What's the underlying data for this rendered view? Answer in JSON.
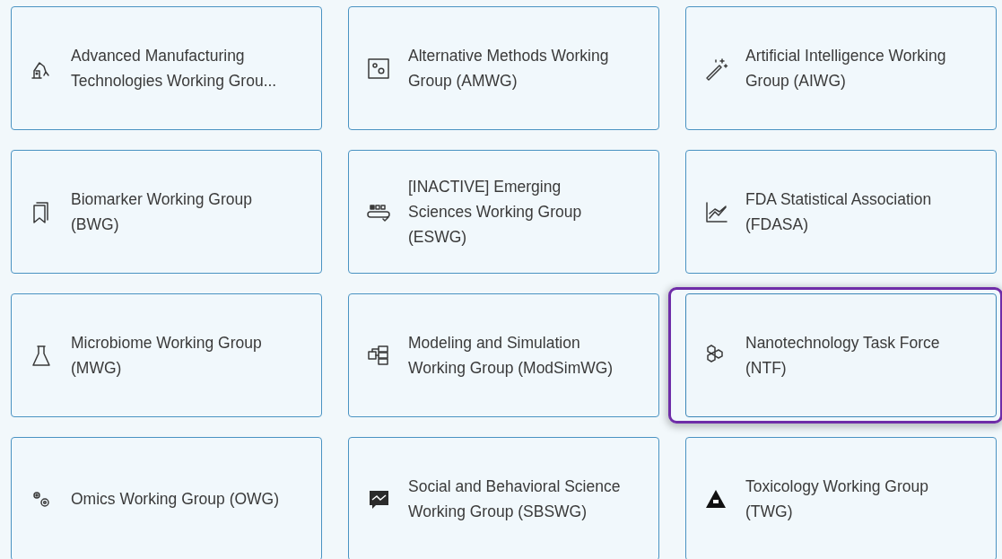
{
  "cards": [
    {
      "title": "Advanced Manufacturing Technologies Working Grou...",
      "focused": false
    },
    {
      "title": "Alternative Methods Working Group (AMWG)",
      "focused": false
    },
    {
      "title": "Artificial Intelligence Working Group (AIWG)",
      "focused": false
    },
    {
      "title": "Biomarker Working Group (BWG)",
      "focused": false
    },
    {
      "title": "[INACTIVE] Emerging Sciences Working Group (ESWG)",
      "focused": false
    },
    {
      "title": "FDA Statistical Association (FDASA)",
      "focused": false
    },
    {
      "title": "Microbiome Working Group (MWG)",
      "focused": false
    },
    {
      "title": "Modeling and Simulation Working Group (ModSimWG)",
      "focused": false
    },
    {
      "title": "Nanotechnology Task Force (NTF)",
      "focused": true
    },
    {
      "title": "Omics Working Group (OWG)",
      "focused": false
    },
    {
      "title": "Social and Behavioral Science Working Group (SBSWG)",
      "focused": false
    },
    {
      "title": "Toxicology Working Group (TWG)",
      "focused": false
    }
  ]
}
